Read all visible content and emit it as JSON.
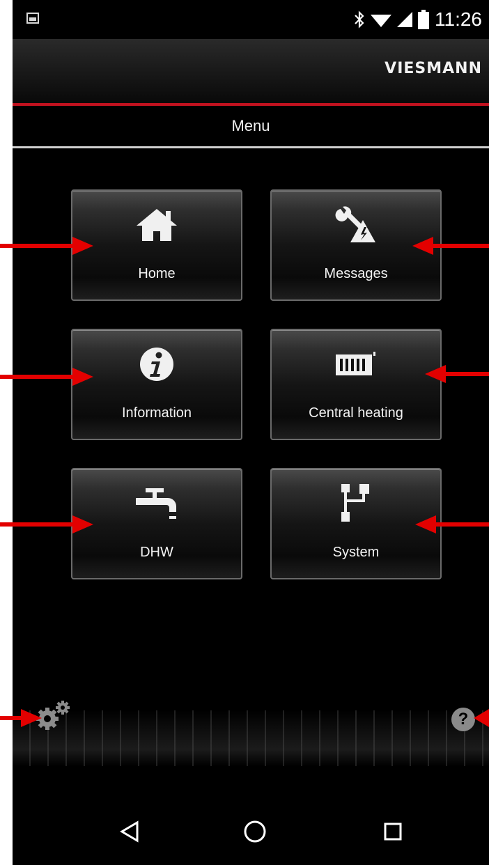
{
  "status_bar": {
    "time": "11:26",
    "icons": [
      "gallery-icon",
      "bluetooth-icon",
      "wifi-icon",
      "cell-signal-icon",
      "battery-icon"
    ]
  },
  "header": {
    "brand": "VIESMANN"
  },
  "page": {
    "title": "Menu"
  },
  "menu": {
    "home": "Home",
    "messages": "Messages",
    "information": "Information",
    "central_heating": "Central heating",
    "dhw": "DHW",
    "system": "System"
  },
  "footer": {
    "settings_icon": "gears-icon",
    "help_icon": "help-icon",
    "help_glyph": "?"
  },
  "colors": {
    "accent_red": "#c1121f",
    "annotation_arrow": "#e30000",
    "background": "#000000",
    "text": "#f2f2f2"
  }
}
